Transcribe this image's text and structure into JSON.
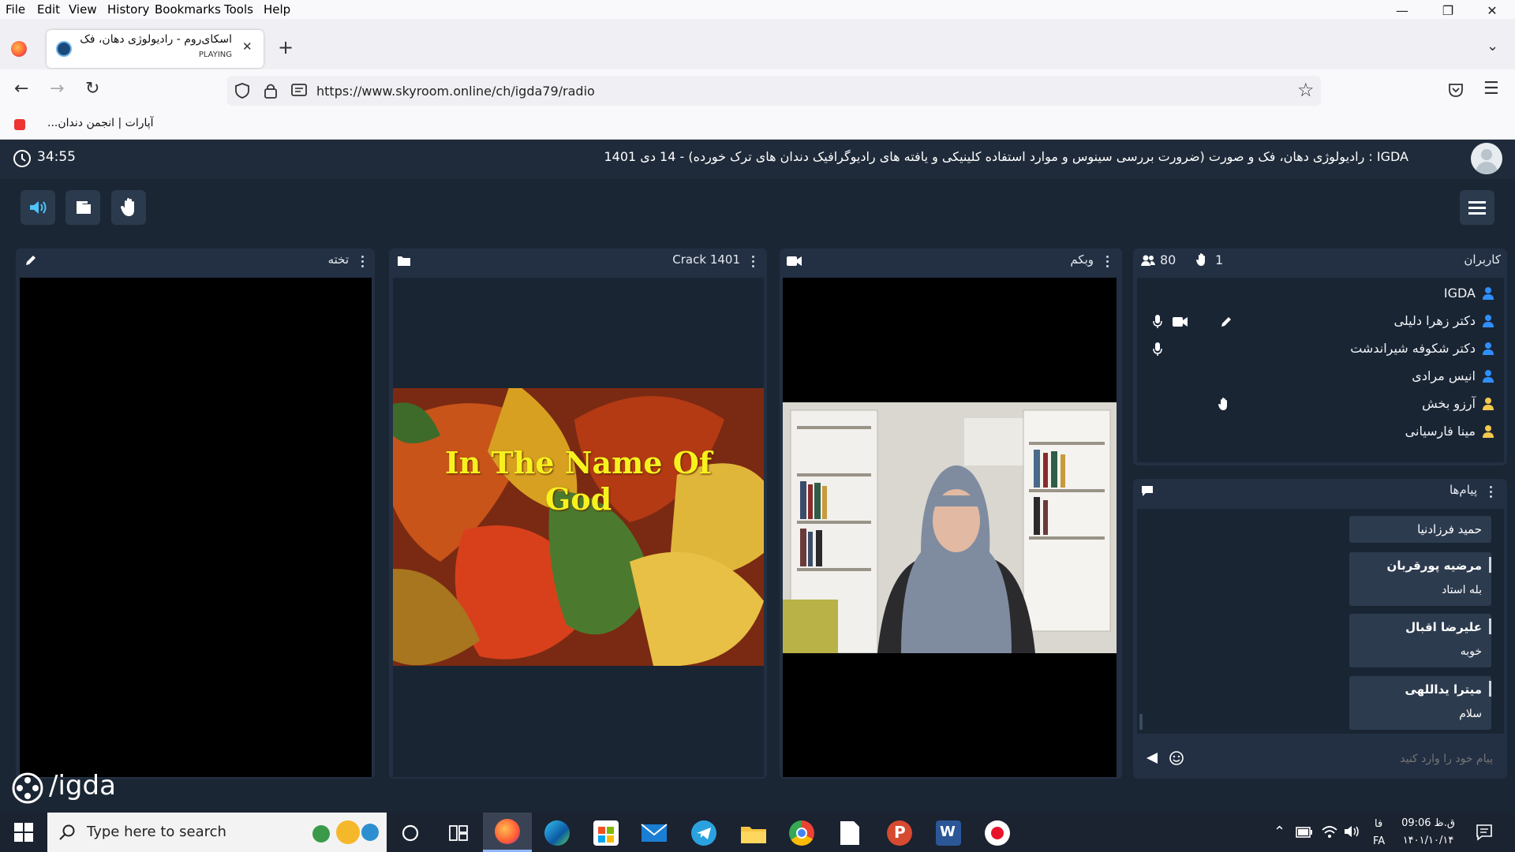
{
  "menu": [
    "File",
    "Edit",
    "View",
    "History",
    "Bookmarks",
    "Tools",
    "Help"
  ],
  "tab": {
    "title": "اسکای‌روم - رادیولوژی دهان، فک",
    "status": "PLAYING"
  },
  "url": "https://www.skyroom.online/ch/igda79/radio",
  "bookmark": "آپارات | انجمن دندان...",
  "timer": "34:55",
  "room_title": "IGDA : رادیولوژی دهان، فک و صورت (ضرورت بررسی سینوس و موارد استفاده کلینیکی و یافته های رادیوگرافیک دندان های ترک خورده) - 14 دی 1401",
  "panels": {
    "board": "تخته",
    "file": "Crack 1401",
    "webcam": "وبکم",
    "users": "کاربران",
    "messages": "پیام‌ها"
  },
  "slide_text": "In The Name Of God",
  "users_count": "80",
  "hands_count": "1",
  "users": [
    {
      "name": "IGDA",
      "color": "#2f8fff"
    },
    {
      "name": "دکتر زهرا دلیلی",
      "color": "#2f8fff"
    },
    {
      "name": "دکتر شکوفه شیراندشت",
      "color": "#2f8fff"
    },
    {
      "name": "انیس مرادی",
      "color": "#2f8fff"
    },
    {
      "name": "آرزو بخش",
      "color": "#f2c94c"
    },
    {
      "name": "مینا فارسیانی",
      "color": "#f2c94c"
    }
  ],
  "messages": [
    {
      "sender": "حمید فرزادنیا",
      "text": ""
    },
    {
      "sender": "مرضیه پورقربان",
      "text": "بله استاد"
    },
    {
      "sender": "علیرضا اقبال",
      "text": "خوبه"
    },
    {
      "sender": "میترا یداللهی",
      "text": "سلام"
    }
  ],
  "message_placeholder": "پیام خود را وارد کنید",
  "watermark": "/igda",
  "taskbar": {
    "search_placeholder": "Type here to search",
    "lang_top": "فا",
    "lang_bottom": "FA",
    "time": "09:06 ق.ظ",
    "date": "۱۴۰۱/۱۰/۱۴"
  }
}
